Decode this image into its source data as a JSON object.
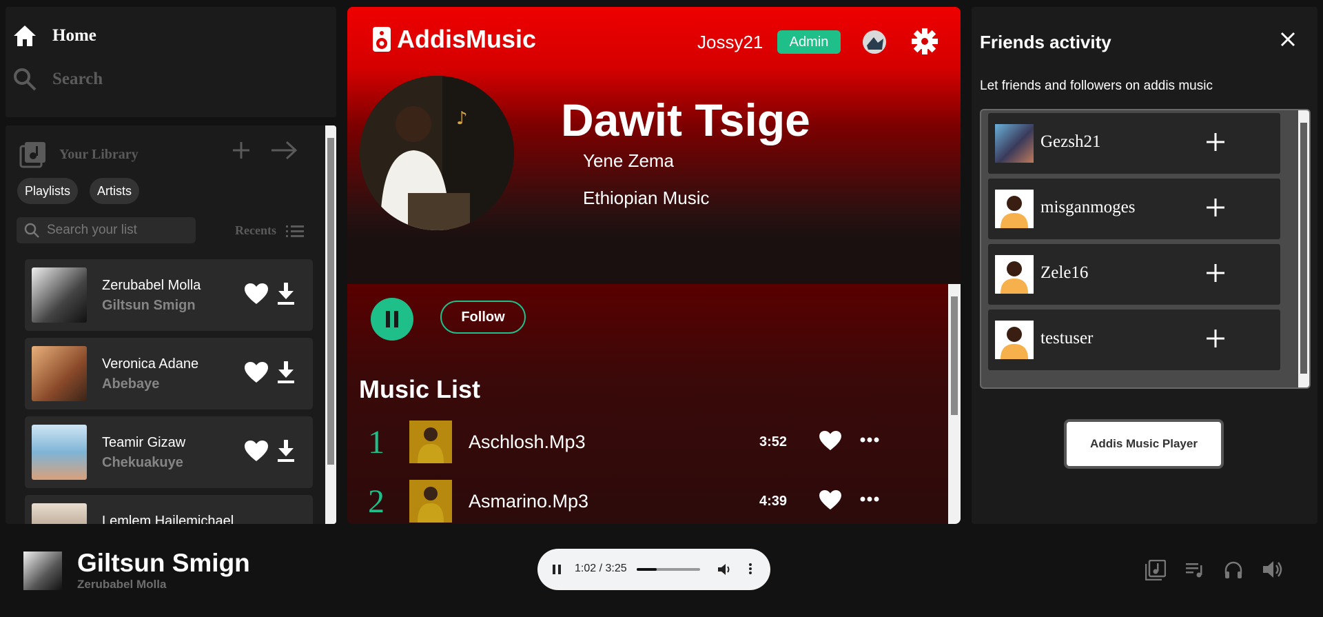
{
  "nav": {
    "home_label": "Home",
    "search_label": "Search"
  },
  "library": {
    "title": "Your Library",
    "filters": [
      "Playlists",
      "Artists"
    ],
    "search_placeholder": "Search your list",
    "sort_label": "Recents",
    "items": [
      {
        "title": "Zerubabel Molla",
        "subtitle": "Giltsun Smign"
      },
      {
        "title": "Veronica Adane",
        "subtitle": "Abebaye"
      },
      {
        "title": "Teamir Gizaw",
        "subtitle": "Chekuakuye"
      },
      {
        "title": "Lemlem Hailemichael",
        "subtitle": ""
      }
    ]
  },
  "header": {
    "brand": "AddisMusic",
    "username": "Jossy21",
    "role_badge": "Admin"
  },
  "artist": {
    "name": "Dawit Tsige",
    "album": "Yene Zema",
    "genre": "Ethiopian Music",
    "follow_label": "Follow"
  },
  "music_list": {
    "title": "Music List",
    "tracks": [
      {
        "number": "1",
        "name": "Aschlosh.Mp3",
        "duration": "3:52"
      },
      {
        "number": "2",
        "name": "Asmarino.Mp3",
        "duration": "4:39"
      }
    ]
  },
  "friends": {
    "title": "Friends activity",
    "description": "Let friends and followers on addis music",
    "list": [
      {
        "name": "Gezsh21"
      },
      {
        "name": "misganmoges"
      },
      {
        "name": "Zele16"
      },
      {
        "name": "testuser"
      }
    ],
    "player_button": "Addis Music Player"
  },
  "now_playing": {
    "title": "Giltsun Smign",
    "artist": "Zerubabel Molla",
    "time": "1:02 / 3:25",
    "progress": 0.32
  },
  "colors": {
    "accent": "#1fbf8a",
    "brand_red": "#ee0000",
    "panel": "#1b1b1b"
  },
  "icons": [
    "home-icon",
    "search-icon",
    "library-icon",
    "plus-icon",
    "arrow-right-icon",
    "list-icon",
    "heart-icon",
    "download-icon",
    "speaker-icon",
    "gear-icon",
    "pause-icon",
    "more-icon",
    "close-icon",
    "volume-icon",
    "kebab-icon",
    "music-note-icon",
    "queue-icon",
    "headphones-icon"
  ]
}
